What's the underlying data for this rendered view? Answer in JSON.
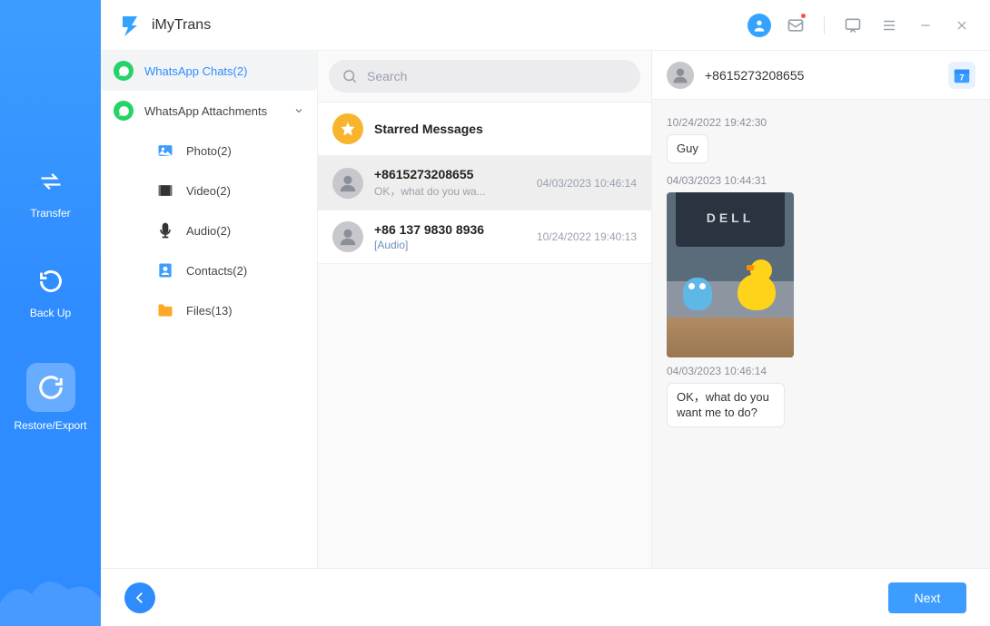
{
  "app": {
    "title": "iMyTrans"
  },
  "nav": {
    "transfer": "Transfer",
    "backup": "Back Up",
    "restore": "Restore/Export"
  },
  "categories": {
    "chats": "WhatsApp Chats(2)",
    "attachments": "WhatsApp Attachments",
    "sub": {
      "photo": "Photo(2)",
      "video": "Video(2)",
      "audio": "Audio(2)",
      "contacts": "Contacts(2)",
      "files": "Files(13)"
    }
  },
  "search": {
    "placeholder": "Search"
  },
  "list": {
    "starred": "Starred Messages",
    "items": [
      {
        "name": "+8615273208655",
        "preview": "OK，what do you wa...",
        "time": "04/03/2023 10:46:14"
      },
      {
        "name": "+86 137 9830 8936",
        "preview": "[Audio]",
        "time": "10/24/2022 19:40:13"
      }
    ]
  },
  "conversation": {
    "contact": "+8615273208655",
    "calendar_day": "7",
    "messages": [
      {
        "stamp": "10/24/2022 19:42:30",
        "text": "Guy",
        "type": "text"
      },
      {
        "stamp": "04/03/2023 10:44:31",
        "type": "image",
        "image_label": "DELL"
      },
      {
        "stamp": "04/03/2023 10:46:14",
        "text": "OK，what do you want me to do?",
        "type": "text"
      }
    ]
  },
  "footer": {
    "next": "Next"
  }
}
